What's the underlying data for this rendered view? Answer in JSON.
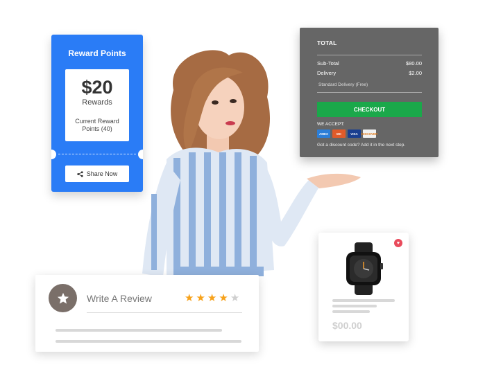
{
  "reward": {
    "title": "Reward Points",
    "amount": "$20",
    "amount_label": "Rewards",
    "points_text": "Current Reward Points (40)",
    "share_label": "Share Now"
  },
  "total": {
    "title": "TOTAL",
    "subtotal_label": "Sub-Total",
    "subtotal_value": "$80.00",
    "delivery_label": "Delivery",
    "delivery_value": "$2.00",
    "delivery_option": "Standard Delivery (Free)",
    "checkout_label": "CHECKOUT",
    "accept_label": "WE ACCEPT:",
    "discount_text": "Got a discount code? Add it in the next step.",
    "cards": [
      {
        "name": "amex",
        "label": "AMEX",
        "color": "#2b7ed8"
      },
      {
        "name": "mastercard",
        "label": "MC",
        "color": "#e05b2a"
      },
      {
        "name": "visa",
        "label": "VISA",
        "color": "#1a3f8f"
      },
      {
        "name": "discover",
        "label": "DISCOVER",
        "color": "#f1f1f1"
      }
    ]
  },
  "product": {
    "price": "$00.00",
    "favorite_color": "#e94b5c"
  },
  "review": {
    "title": "Write A Review",
    "rating": 4,
    "max_rating": 5,
    "star_color": "#f7a21b"
  },
  "colors": {
    "reward_blue": "#2a7cf6",
    "total_gray": "#666666",
    "checkout_green": "#1aa84a"
  }
}
